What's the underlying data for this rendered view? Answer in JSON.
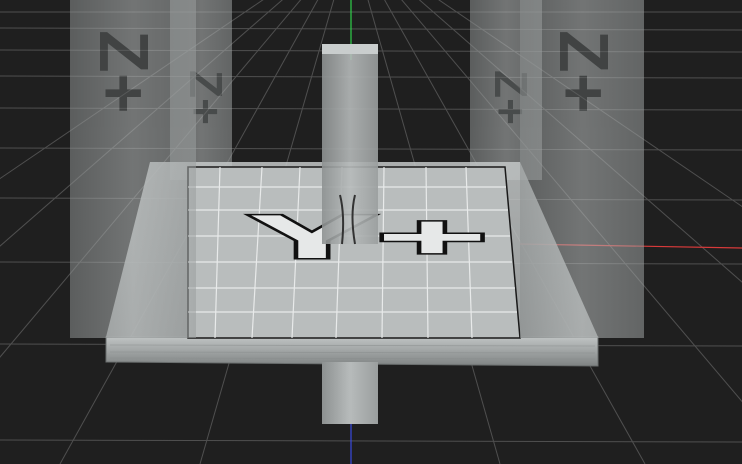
{
  "viewport": {
    "background": "#1f1f1f",
    "grid_color": "#5a5a5a",
    "axis_x_color": "#d83a3a",
    "axis_y_color": "#2fd04a",
    "axis_z_color": "#3a4ae0"
  },
  "scene": {
    "floor_label": "Y+",
    "pillar_label_left_front": "Z+",
    "pillar_label_left_back": "Z+",
    "pillar_label_right_front": "Z+",
    "pillar_label_right_back": "Z+",
    "platform_color": "#b8bcbc",
    "slab_color": "#9ea2a2",
    "pillar_color": "#c8cccc"
  }
}
